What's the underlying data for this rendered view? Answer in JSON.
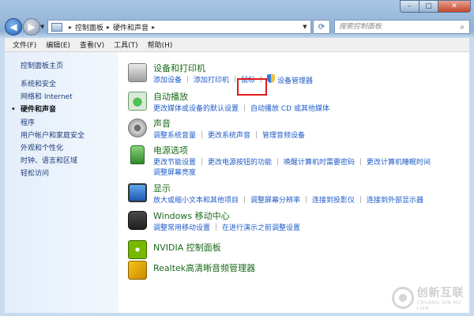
{
  "window": {
    "caption": {
      "minimize": "–",
      "maximize": "□",
      "close": "✕"
    }
  },
  "address_bar": {
    "breadcrumb": [
      "控制面板",
      "硬件和声音"
    ],
    "separator": "▸",
    "search_placeholder": "搜索控制面板"
  },
  "menu": [
    "文件(F)",
    "编辑(E)",
    "查看(V)",
    "工具(T)",
    "帮助(H)"
  ],
  "sidebar": {
    "home": "控制面板主页",
    "items": [
      {
        "label": "系统和安全",
        "active": false
      },
      {
        "label": "网络和 Internet",
        "active": false
      },
      {
        "label": "硬件和声音",
        "active": true
      },
      {
        "label": "程序",
        "active": false
      },
      {
        "label": "用户帐户和家庭安全",
        "active": false
      },
      {
        "label": "外观和个性化",
        "active": false
      },
      {
        "label": "时钟、语言和区域",
        "active": false
      },
      {
        "label": "轻松访问",
        "active": false
      }
    ]
  },
  "categories": {
    "devices": {
      "title": "设备和打印机",
      "links": [
        "添加设备",
        "添加打印机",
        "鼠标",
        "设备管理器"
      ],
      "icon": "printer-icon",
      "highlighted_link": "鼠标"
    },
    "autoplay": {
      "title": "自动播放",
      "links": [
        "更改媒体或设备的默认设置",
        "自动播放 CD 或其他媒体"
      ],
      "icon": "autoplay-icon"
    },
    "sound": {
      "title": "声音",
      "links": [
        "调整系统音量",
        "更改系统声音",
        "管理音频设备"
      ],
      "icon": "speaker-icon"
    },
    "power": {
      "title": "电源选项",
      "links": [
        "更改节能设置",
        "更改电源按钮的功能",
        "唤醒计算机时需要密码",
        "更改计算机睡眠时间",
        "调整屏幕亮度"
      ],
      "icon": "battery-icon"
    },
    "display": {
      "title": "显示",
      "links": [
        "放大或缩小文本和其他项目",
        "调整屏幕分辨率",
        "连接到投影仪",
        "连接到外部显示器"
      ],
      "icon": "monitor-icon"
    },
    "mobility": {
      "title": "Windows 移动中心",
      "links": [
        "调整常用移动设置",
        "在进行演示之前调整设置"
      ],
      "icon": "mobility-center-icon"
    },
    "nvidia": {
      "title": "NVIDIA 控制面板",
      "icon": "nvidia-icon"
    },
    "realtek": {
      "title": "Realtek高清晰音频管理器",
      "icon": "realtek-audio-icon"
    }
  },
  "watermark": {
    "chinese": "创新互联",
    "english": "CHUANG XIN HU LIAN"
  },
  "colors": {
    "link": "#1e5bc8",
    "title": "#1a6a1a",
    "highlight": "#e01b1b"
  }
}
